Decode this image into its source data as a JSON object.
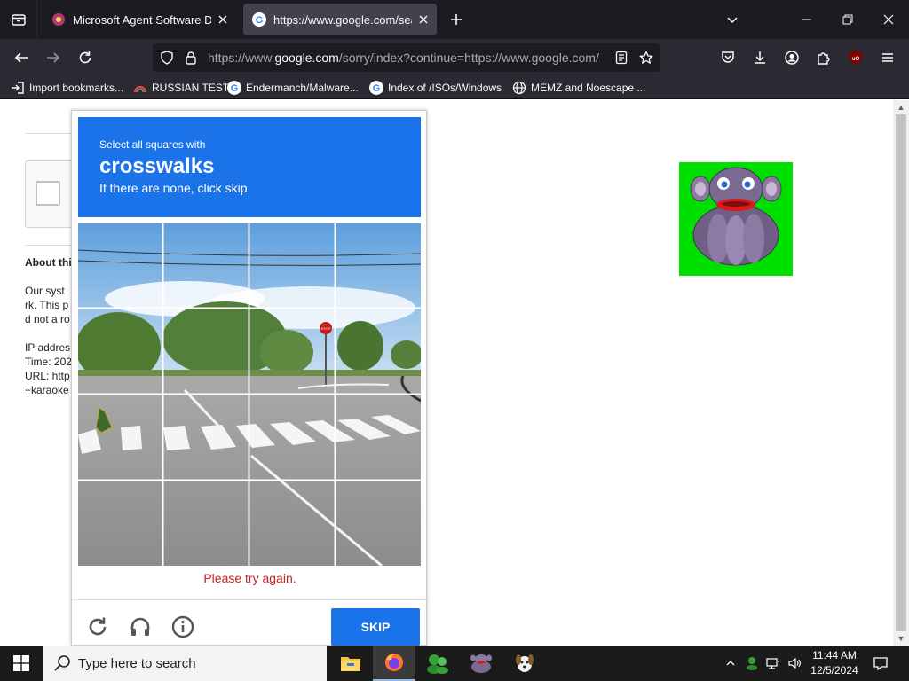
{
  "browser": {
    "tabs": [
      {
        "title": "Microsoft Agent Software Downl",
        "active": false
      },
      {
        "title": "https://www.google.com/search",
        "active": true
      }
    ],
    "url_prefix": "https://www.",
    "url_domain": "google.com",
    "url_rest": "/sorry/index?continue=https://www.google.com/",
    "bookmarks": [
      {
        "label": "Import bookmarks...",
        "icon": "import-icon"
      },
      {
        "label": "RUSSIAN TEST",
        "icon": "rainbow-icon"
      },
      {
        "label": "Endermanch/Malware...",
        "icon": "google-icon"
      },
      {
        "label": "Index of /ISOs/Windows",
        "icon": "google-icon"
      },
      {
        "label": "MEMZ and Noescape ...",
        "icon": "globe-icon"
      }
    ],
    "colors": {
      "tabbar": "#1c1b22",
      "toolbar": "#2b2a33",
      "active_tab": "#42414d",
      "ublock": "#800000"
    }
  },
  "page": {
    "about_heading": "About thi",
    "lines": [
      "Our syst",
      "rk. This p",
      "d not a ro",
      "IP addres",
      "Time: 202",
      "URL: http",
      "+karaoke"
    ]
  },
  "captcha": {
    "instruction": "Select all squares with",
    "target": "crosswalks",
    "hint": "If there are none, click skip",
    "error": "Please try again.",
    "skip_label": "SKIP",
    "sign_text": "STOP",
    "accent": "#1a73e8",
    "error_color": "#c5221f"
  },
  "taskbar": {
    "search_placeholder": "Type here to search",
    "time": "11:44 AM",
    "date": "12/5/2024",
    "apps": [
      "file-explorer-icon",
      "firefox-icon",
      "bonzi-buddy-icon",
      "monkey-icon",
      "dog-icon"
    ]
  }
}
